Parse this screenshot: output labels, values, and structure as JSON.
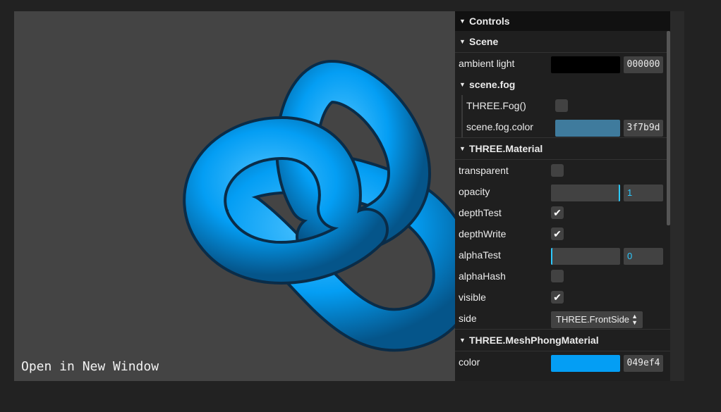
{
  "viewport": {
    "link_text": "Open in New Window",
    "background": "#444444",
    "knot_color": "#049ef4"
  },
  "gui": {
    "title": "Controls",
    "scene": {
      "title": "Scene",
      "ambient_light": {
        "label": "ambient light",
        "swatch": "#000000",
        "hex": "000000"
      },
      "fog": {
        "title": "scene.fog",
        "type_label": "THREE.Fog()",
        "type_enabled": false,
        "color_label": "scene.fog.color",
        "color_swatch": "#3f7b9d",
        "color_hex": "3f7b9d"
      }
    },
    "material": {
      "title": "THREE.Material",
      "transparent": {
        "label": "transparent",
        "checked": false
      },
      "opacity": {
        "label": "opacity",
        "value": "1",
        "fraction": 1
      },
      "depthTest": {
        "label": "depthTest",
        "checked": true
      },
      "depthWrite": {
        "label": "depthWrite",
        "checked": true
      },
      "alphaTest": {
        "label": "alphaTest",
        "value": "0",
        "fraction": 0
      },
      "alphaHash": {
        "label": "alphaHash",
        "checked": false
      },
      "visible": {
        "label": "visible",
        "checked": true
      },
      "side": {
        "label": "side",
        "value": "THREE.FrontSide"
      }
    },
    "phong": {
      "title": "THREE.MeshPhongMaterial",
      "color": {
        "label": "color",
        "swatch": "#049ef4",
        "hex": "049ef4"
      }
    }
  }
}
